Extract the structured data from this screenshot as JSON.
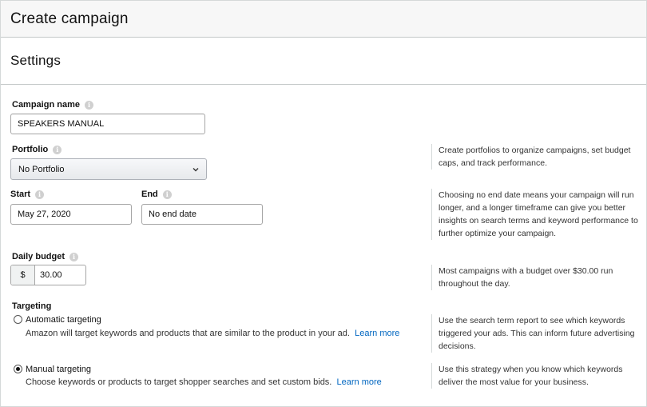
{
  "header": {
    "title": "Create campaign"
  },
  "settings": {
    "title": "Settings",
    "campaign_name": {
      "label": "Campaign name",
      "value": "SPEAKERS MANUAL"
    },
    "portfolio": {
      "label": "Portfolio",
      "value": "No Portfolio",
      "help": "Create portfolios to organize campaigns, set budget caps, and track performance."
    },
    "start": {
      "label": "Start",
      "value": "May 27, 2020"
    },
    "end": {
      "label": "End",
      "value": "No end date"
    },
    "dates_help": "Choosing no end date means your campaign will run longer, and a longer timeframe can give you better insights on search terms and keyword performance to further optimize your campaign.",
    "daily_budget": {
      "label": "Daily budget",
      "currency": "$",
      "value": "30.00",
      "help": "Most campaigns with a budget over $30.00 run throughout the day."
    },
    "targeting": {
      "label": "Targeting",
      "automatic": {
        "title": "Automatic targeting",
        "desc_line1": "Amazon will target keywords and products that are similar to the product in your ad.",
        "link_line1": "Learn",
        "link_line2": "more",
        "help": "Use the search term report to see which keywords triggered your ads. This can inform future advertising decisions.",
        "selected": false
      },
      "manual": {
        "title": "Manual targeting",
        "desc": "Choose keywords or products to target shopper searches and set custom bids.",
        "link": "Learn more",
        "help": "Use this strategy when you know which keywords deliver the most value for your business.",
        "selected": true
      }
    }
  },
  "icons": {
    "info": "info-icon",
    "chevron": "chevron-down-icon"
  },
  "colors": {
    "link": "#0066c0",
    "header_bg": "#f7f7f7",
    "border": "#d5d9d9"
  }
}
